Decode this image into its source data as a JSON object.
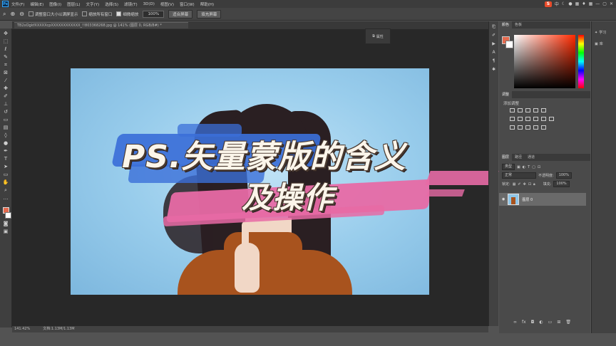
{
  "app": {
    "logo": "Ps"
  },
  "menu": [
    "文件(F)",
    "编辑(E)",
    "图像(I)",
    "图层(L)",
    "文字(Y)",
    "选择(S)",
    "滤镜(T)",
    "3D(D)",
    "视图(V)",
    "窗口(W)",
    "帮助(H)"
  ],
  "system_tray": {
    "ime_logo": "S",
    "ime_mode": "中"
  },
  "options_bar": {
    "resize_windows": "调整窗口大小以满屏显示",
    "zoom_all_windows": "缩放所有窗口",
    "scrubby_zoom": "细微缩放",
    "zoom_value": "100%",
    "fit_screen": "适合屏幕",
    "fill_screen": "填充屏幕"
  },
  "document": {
    "tab_title": "TB2xOgkfXXXXXcpXXXXXXXXXXXX_!!803368268.jpg @ 141% (图层 0, RGB/8#) *",
    "status_zoom": "141.42%",
    "status_doc": "文档:1.13M/1.13M"
  },
  "artwork": {
    "headline_line1": "PS.矢量蒙版的含义",
    "headline_line2": "及操作"
  },
  "properties_tab": {
    "label": "属性"
  },
  "color_panel": {
    "tabs": [
      "颜色",
      "色板"
    ],
    "fg_color": "#e46a4e",
    "bg_color": "#ffffff"
  },
  "adjustments_panel": {
    "tab": "调整",
    "subtitle": "添加调整"
  },
  "layers_panel": {
    "tabs": [
      "图层",
      "路径",
      "通道"
    ],
    "filter_label": "类型",
    "blend_mode": "正常",
    "opacity_label": "不透明度:",
    "opacity_value": "100%",
    "lock_label": "锁定:",
    "fill_label": "填充:",
    "fill_value": "100%",
    "layer_name": "图层 0"
  },
  "learn_panel": {
    "learn": "学习",
    "library": "库"
  }
}
